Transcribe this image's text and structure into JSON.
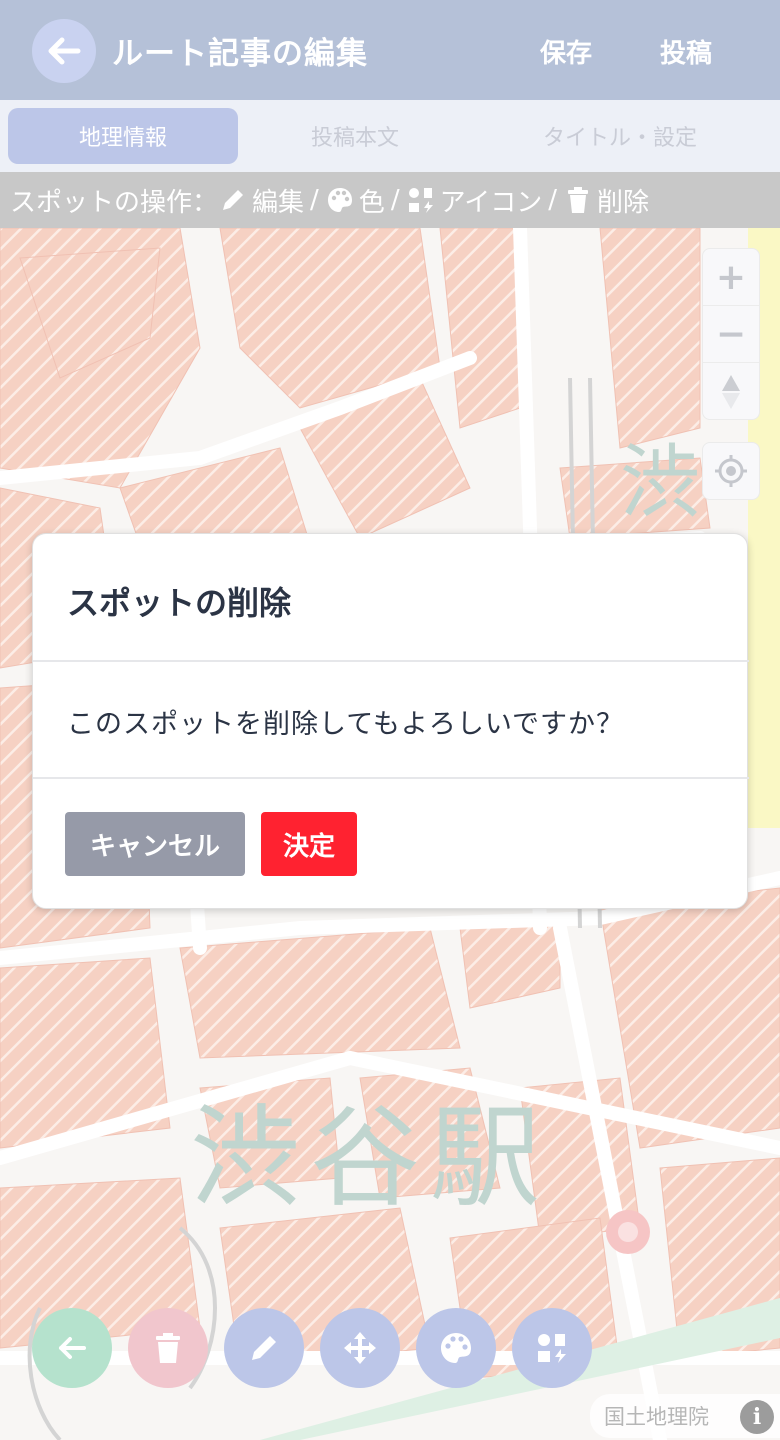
{
  "header": {
    "title": "ルート記事の編集",
    "save_label": "保存",
    "post_label": "投稿"
  },
  "tabs": [
    {
      "label": "地理情報",
      "active": true
    },
    {
      "label": "投稿本文",
      "active": false
    },
    {
      "label": "タイトル・設定",
      "active": false
    }
  ],
  "ops_bar": {
    "prefix": "スポットの操作：",
    "edit": "編集",
    "color": "色",
    "icon": "アイコン",
    "delete": "削除",
    "separator": "/"
  },
  "map": {
    "station_label": "渋谷駅",
    "area_label_top": "渋",
    "attribution": "国土地理院",
    "info_label": "i",
    "zoom_in": "+",
    "zoom_out": "−"
  },
  "modal": {
    "title": "スポットの削除",
    "message": "このスポットを削除してもよろしいですか？",
    "cancel_label": "キャンセル",
    "confirm_label": "決定"
  },
  "fabs": [
    "arrow-left-icon",
    "trash-icon",
    "pencil-icon",
    "move-icon",
    "palette-icon",
    "icons-icon"
  ],
  "colors": {
    "header_bg": "#b5c1d8",
    "tab_active": "#bcc6e8",
    "ops_bar_bg": "#c8c8c8",
    "cancel_btn": "#969aa8",
    "confirm_btn": "#ff2230"
  }
}
